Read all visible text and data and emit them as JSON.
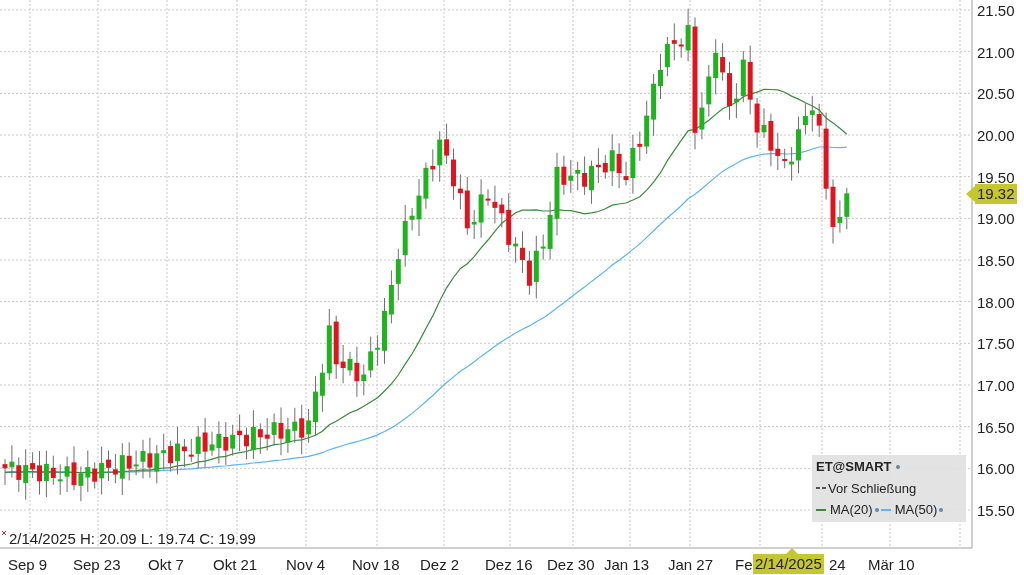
{
  "chart": {
    "y_axis_labels": [
      "21.50",
      "21.00",
      "20.50",
      "20.00",
      "19.50",
      "19.00",
      "18.50",
      "18.00",
      "17.50",
      "17.00",
      "16.50",
      "16.00",
      "15.50"
    ],
    "x_axis_labels": [
      "Sep 9",
      "Sep 23",
      "Okt 7",
      "Okt 21",
      "Nov 4",
      "Nov 18",
      "Dez 2",
      "Dez 16",
      "Dez 30",
      "Jan 13",
      "Jan 27",
      "Fe",
      "24",
      "Mär 10"
    ],
    "price_tag": "19.32",
    "info_line": "2/14/2025 H: 20.09 L: 19.74 C: 19.99",
    "crosshair_date": "2/14/2025"
  },
  "legend": {
    "title": "ET@SMART",
    "items": [
      {
        "label": "Vor Schließung",
        "kind": "dashed",
        "color": "#555555"
      },
      {
        "label": "MA(20)",
        "kind": "solid",
        "color": "#3a8a3a"
      },
      {
        "label": "MA(50)",
        "kind": "solid",
        "color": "#5ab4f5"
      }
    ]
  }
}
